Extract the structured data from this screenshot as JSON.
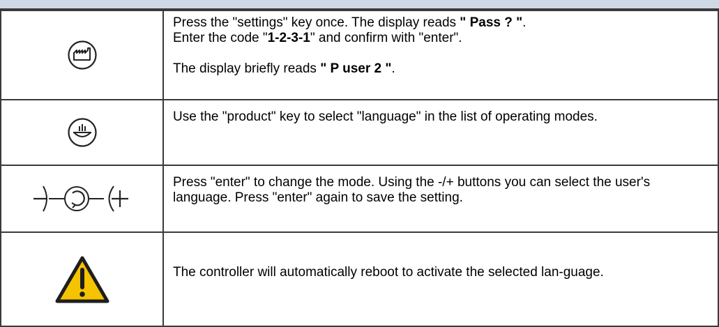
{
  "steps": [
    {
      "icon": "settings-factory-icon",
      "line1_pre": "Press the \"settings\" key once. The display reads ",
      "line1_bold": "\" Pass ? \"",
      "line1_post": ".",
      "line2_pre": "Enter the code \"",
      "line2_bold": "1-2-3-1",
      "line2_post": "\" and confirm with \"enter\".",
      "line3_pre": "The display briefly reads ",
      "line3_bold": "\" P user 2 \"",
      "line3_post": "."
    },
    {
      "icon": "product-key-icon",
      "text": "Use the \"product\" key to select \"language\" in the list of operating modes."
    },
    {
      "icon": "minus-enter-plus-icon",
      "text": "Press \"enter\" to change the mode. Using the -/+ buttons you can select the user's language. Press \"enter\" again to save the setting."
    },
    {
      "icon": "warning-icon",
      "text": "The controller will automatically reboot to activate the selected lan-guage."
    }
  ],
  "colors": {
    "border": "#3a3a3a",
    "header_band": "#cfd9e6",
    "warning_yellow": "#f5c400"
  }
}
